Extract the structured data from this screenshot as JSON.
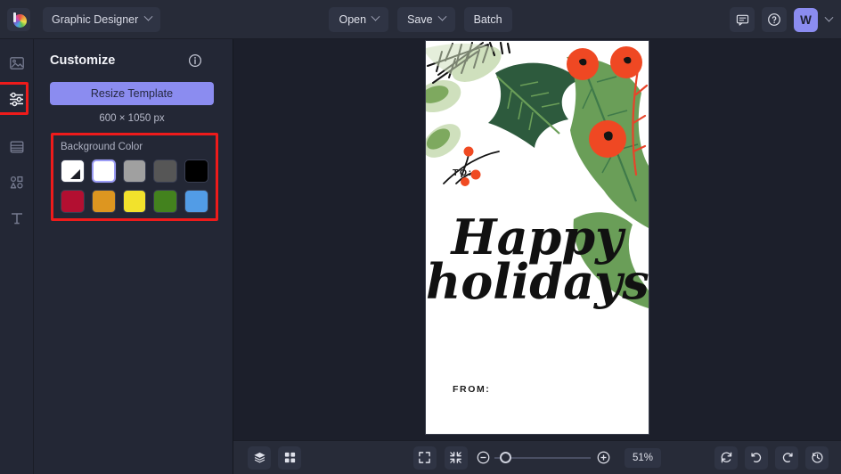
{
  "app": {
    "logo": "befunky-logo-icon",
    "switcher_label": "Graphic Designer"
  },
  "topbar": {
    "open_label": "Open",
    "save_label": "Save",
    "batch_label": "Batch",
    "feedback_icon": "comment-icon",
    "help_icon": "help-circle-icon",
    "avatar_initial": "W"
  },
  "rail": {
    "items": [
      {
        "icon": "image-icon",
        "name": "image-tool",
        "selected": false
      },
      {
        "icon": "sliders-icon",
        "name": "customize-tool",
        "selected": true
      },
      {
        "icon": "layout-icon",
        "name": "layout-tool",
        "selected": false
      },
      {
        "icon": "shapes-icon",
        "name": "graphics-tool",
        "selected": false
      },
      {
        "icon": "text-icon",
        "name": "text-tool",
        "selected": false
      }
    ]
  },
  "panel": {
    "title": "Customize",
    "info_icon": "info-circle-icon",
    "resize_button": "Resize Template",
    "dimensions": "600 × 1050 px",
    "background_color": {
      "label": "Background Color",
      "swatches": [
        {
          "name": "transparent",
          "color": "#ffffff",
          "transparent": true,
          "selected": false
        },
        {
          "name": "white",
          "color": "#ffffff",
          "selected": true
        },
        {
          "name": "light-gray",
          "color": "#a0a0a0",
          "selected": false
        },
        {
          "name": "dark-gray",
          "color": "#565656",
          "selected": false
        },
        {
          "name": "black",
          "color": "#000000",
          "selected": false
        },
        {
          "name": "crimson",
          "color": "#b30f31",
          "selected": false
        },
        {
          "name": "amber",
          "color": "#dd9620",
          "selected": false
        },
        {
          "name": "yellow",
          "color": "#f2e22c",
          "selected": false
        },
        {
          "name": "green",
          "color": "#43821e",
          "selected": false
        },
        {
          "name": "blue",
          "color": "#529ce6",
          "selected": false
        }
      ]
    }
  },
  "canvas": {
    "to_label": "TO:",
    "from_label": "FROM:",
    "greeting_line1": "Happy",
    "greeting_line2": "holidays",
    "background": "#ffffff",
    "art_colors": {
      "holly_dark": "#2d5a3d",
      "holly_mid": "#6a9e58",
      "holly_light": "#b8d4a8",
      "berry_red": "#ef4823",
      "needle_black": "#111111",
      "berry_small": "#f04a22"
    }
  },
  "bottombar": {
    "layers_icon": "layers-icon",
    "grid_icon": "grid-icon",
    "fullscreen_icon": "expand-icon",
    "fit_icon": "collapse-icon",
    "zoom_out_icon": "minus-circle-icon",
    "zoom_in_icon": "plus-circle-icon",
    "zoom_level": "51%",
    "reset_icon": "reset-icon",
    "undo_icon": "undo-icon",
    "redo_icon": "redo-icon",
    "history_icon": "history-icon"
  },
  "annotations": {
    "highlight_color": "#ee1b1b",
    "boxes": [
      "customize-tool-rail-icon",
      "background-color-section"
    ]
  }
}
